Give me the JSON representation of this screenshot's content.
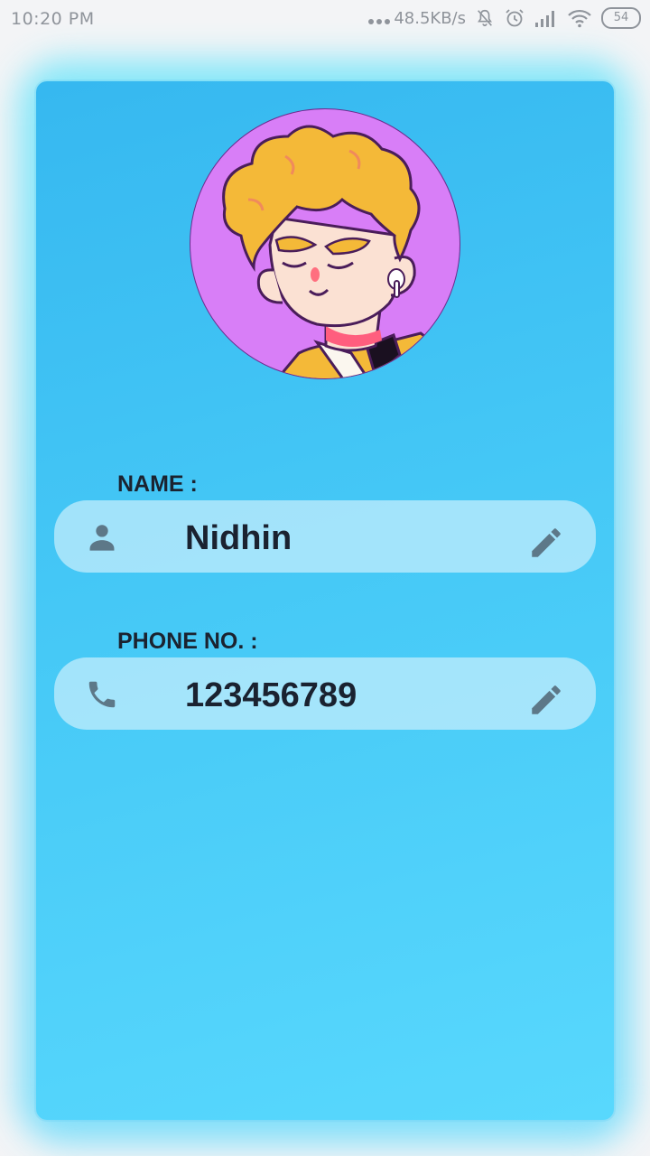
{
  "status_bar": {
    "time": "10:20 PM",
    "network_speed": "48.5KB/s",
    "battery": "54",
    "icons": [
      "dots-icon",
      "muted-bell-icon",
      "alarm-icon",
      "signal-icon",
      "wifi-icon",
      "battery-icon"
    ]
  },
  "profile": {
    "avatar_icon": "avatar-illustration",
    "name_label": "NAME :",
    "name_value": "Nidhin",
    "phone_label": "PHONE NO. :",
    "phone_value": "123456789",
    "icons": [
      "person-icon",
      "phone-icon",
      "edit-icon"
    ]
  },
  "colors": {
    "card_top": "#36b8f0",
    "card_bottom": "#58d8fd",
    "pill": "#bfeafb",
    "text_dark": "#1b2330",
    "icon_gray": "#5d7888",
    "avatar_bg": "#d87ef7"
  }
}
